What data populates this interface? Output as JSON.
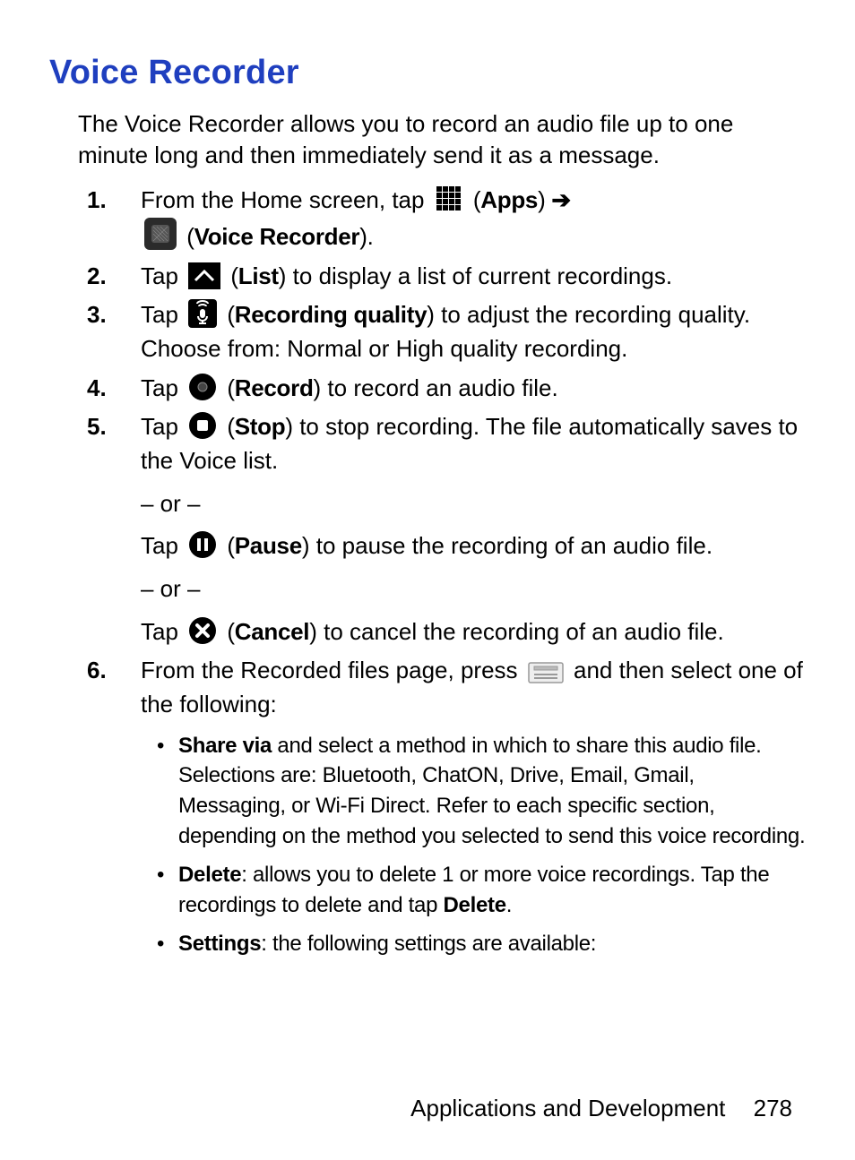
{
  "title": "Voice Recorder",
  "intro": "The Voice Recorder allows you to record an audio file up to one minute long and then immediately send it as a message.",
  "steps": {
    "s1": {
      "t1": "From the Home screen, tap ",
      "apps": "Apps",
      "t2": " (",
      "t3": ") ",
      "vr": "Voice Recorder",
      "t4": " (",
      "t5": ")."
    },
    "s2": {
      "t1": "Tap ",
      "list": "List",
      "t2": " (",
      "t3": ") to display a list of current recordings."
    },
    "s3": {
      "t1": "Tap ",
      "rq": "Recording quality",
      "t2": " (",
      "t3": ") to adjust the recording quality. Choose from: Normal or High quality recording."
    },
    "s4": {
      "t1": "Tap ",
      "rec": "Record",
      "t2": " (",
      "t3": ") to record an audio file."
    },
    "s5": {
      "t1": "Tap ",
      "stop": "Stop",
      "t2": " (",
      "t3": ") to stop recording. The file automatically saves to the Voice list.",
      "or1": "– or –",
      "t4": "Tap ",
      "pause": "Pause",
      "t5": " (",
      "t6": ") to pause the recording of an audio file.",
      "or2": "– or –",
      "t7": "Tap ",
      "cancel": "Cancel",
      "t8": " (",
      "t9": ") to cancel the recording of an audio file."
    },
    "s6": {
      "t1": "From the Recorded files page, press ",
      "t2": " and then select one of the following:",
      "bullets": {
        "share_b": "Share via",
        "share_t": " and select a method in which to share this audio file. Selections are: Bluetooth, ChatON, Drive, Email, Gmail, Messaging, or Wi-Fi Direct. Refer to each specific section, depending on the method you selected to send this voice recording.",
        "delete_b": "Delete",
        "delete_t1": ": allows you to delete 1 or more voice recordings. Tap the recordings to delete and tap ",
        "delete_b2": "Delete",
        "delete_t2": ".",
        "settings_b": "Settings",
        "settings_t": ": the following settings are available:"
      }
    }
  },
  "footer": {
    "section": "Applications and Development",
    "page": "278"
  }
}
